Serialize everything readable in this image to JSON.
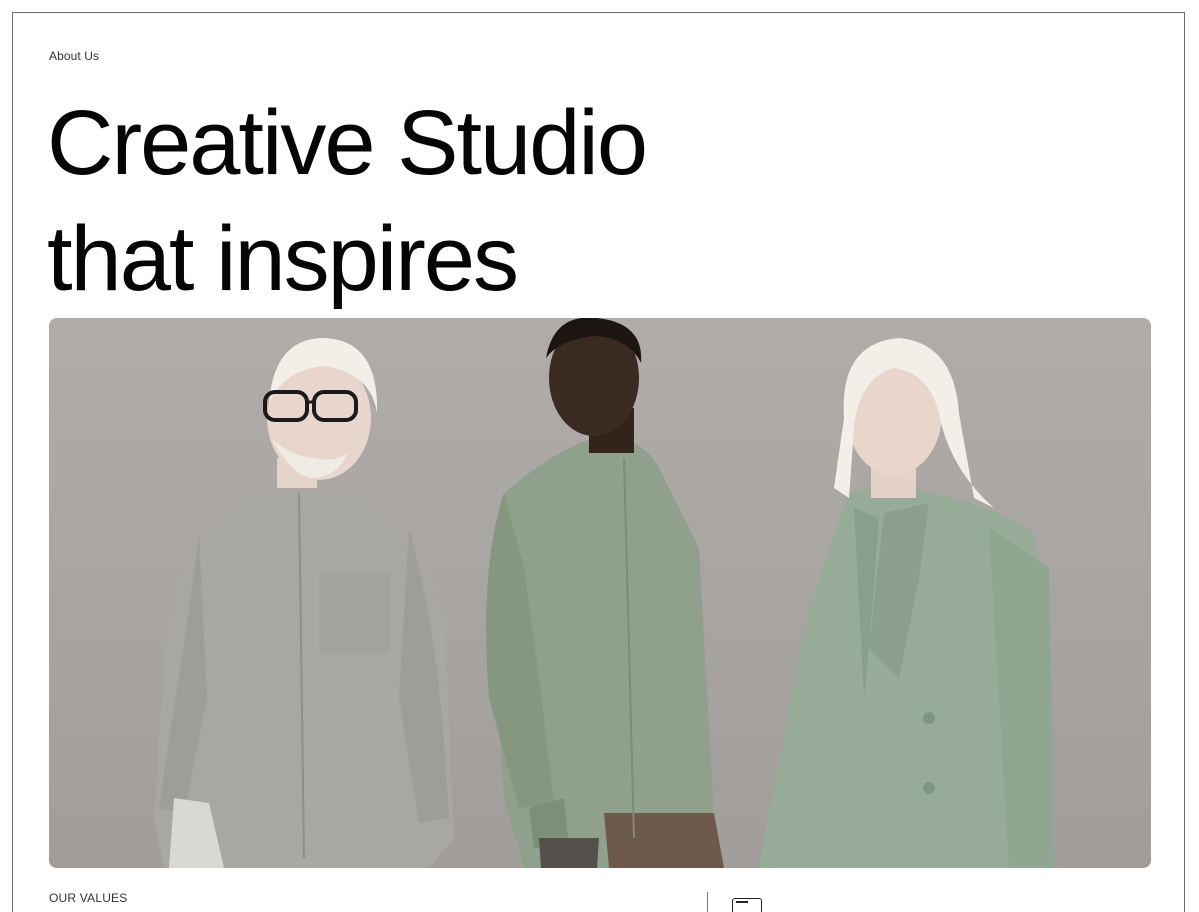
{
  "page": {
    "eyebrow": "About Us",
    "headline_line1": "Creative Studio",
    "headline_line2": "that inspires"
  },
  "hero": {
    "icon": "team-photo",
    "palette": {
      "backdrop": "#aba7a5",
      "grey_shirt": "#a8a7a2",
      "sage_shirt": "#8fa18d",
      "sage_blazer": "#96ac99",
      "skin_light": "#e8d6cc",
      "skin_dark": "#3a2a22",
      "hair_light": "#f1efe8"
    }
  },
  "values": {
    "label": "OUR VALUES"
  },
  "colors": {
    "border": "#6b6b6b",
    "text": "#050505"
  }
}
